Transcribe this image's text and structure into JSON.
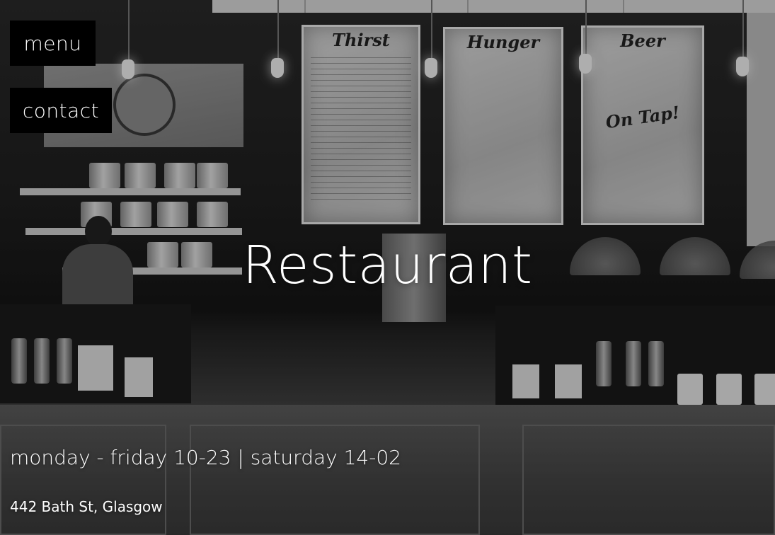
{
  "nav": {
    "menu_label": "menu",
    "contact_label": "contact"
  },
  "hero": {
    "title": "Restaurant"
  },
  "info": {
    "hours": "monday - friday 10-23 | saturday 14-02",
    "address": "442 Bath St, Glasgow"
  },
  "background": {
    "boards": [
      {
        "title": "Thirst"
      },
      {
        "title": "Hunger"
      },
      {
        "title": "Beer",
        "note": "On Tap!"
      }
    ],
    "colors": {
      "nav_bg": "#000000",
      "text": "#ffffff"
    }
  }
}
